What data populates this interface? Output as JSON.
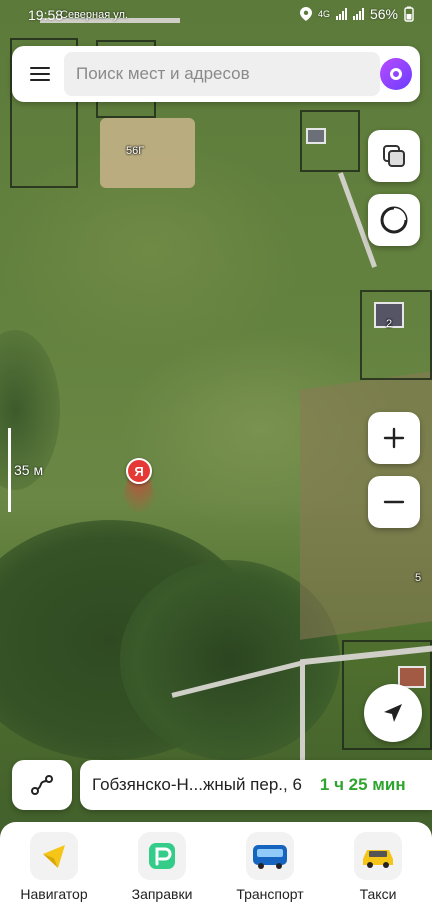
{
  "status_bar": {
    "time": "19:58",
    "road_label": "Северная ул.",
    "battery": "56%",
    "network": "4G"
  },
  "search": {
    "placeholder": "Поиск мест и адресов"
  },
  "map": {
    "labels": [
      "56Г",
      "2",
      "5"
    ],
    "scale_label": "35 м",
    "user_marker_letter": "Я"
  },
  "route": {
    "destination": "Гобзянско-Н...жный пер., 6",
    "duration": "1 ч 25 мин"
  },
  "services": [
    {
      "label": "Навигатор",
      "icon": "navigator-arrow-icon",
      "color": "#f5c518"
    },
    {
      "label": "Заправки",
      "icon": "fuel-icon",
      "color": "#33cc88"
    },
    {
      "label": "Транспорт",
      "icon": "bus-icon",
      "color": "#1565c0"
    },
    {
      "label": "Такси",
      "icon": "taxi-icon",
      "color": "#f5c518"
    }
  ],
  "colors": {
    "accent_green": "#2fa52f",
    "marker_red": "#e53935",
    "alice_purple": "#8a3cff"
  }
}
